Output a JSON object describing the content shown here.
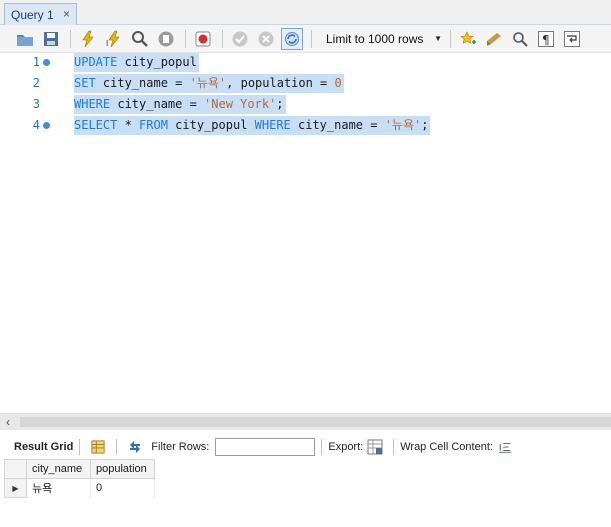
{
  "tab": {
    "title": "Query 1",
    "close": "×"
  },
  "toolbar": {
    "limit_label": "Limit to 1000 rows",
    "icons": [
      "open-folder-icon",
      "save-icon",
      "execute-icon",
      "execute-current-icon",
      "explain-icon",
      "stop-icon",
      "toggle-stop-on-error-icon",
      "commit-icon",
      "rollback-icon",
      "autocommit-icon",
      "beautify-icon",
      "find-icon",
      "invisible-chars-icon",
      "wrap-icon"
    ]
  },
  "editor": {
    "lines": [
      {
        "n": "1",
        "tokens": [
          {
            "t": "kw",
            "v": "UPDATE"
          },
          {
            "t": "plain",
            "v": " city_popul"
          }
        ]
      },
      {
        "n": "2",
        "tokens": [
          {
            "t": "kw",
            "v": "SET"
          },
          {
            "t": "plain",
            "v": " city_name = "
          },
          {
            "t": "str",
            "v": "'뉴욕'"
          },
          {
            "t": "plain",
            "v": ", population = "
          },
          {
            "t": "num",
            "v": "0"
          }
        ]
      },
      {
        "n": "3",
        "tokens": [
          {
            "t": "kw",
            "v": "WHERE"
          },
          {
            "t": "plain",
            "v": " city_name = "
          },
          {
            "t": "str",
            "v": "'New York'"
          },
          {
            "t": "plain",
            "v": ";"
          }
        ]
      },
      {
        "n": "4",
        "tokens": [
          {
            "t": "kw",
            "v": "SELECT"
          },
          {
            "t": "plain",
            "v": " * "
          },
          {
            "t": "kw",
            "v": "FROM"
          },
          {
            "t": "plain",
            "v": " city_popul "
          },
          {
            "t": "kw",
            "v": "WHERE"
          },
          {
            "t": "plain",
            "v": " city_name = "
          },
          {
            "t": "str",
            "v": "'뉴욕'"
          },
          {
            "t": "plain",
            "v": ";"
          }
        ]
      }
    ]
  },
  "results": {
    "result_grid_label": "Result Grid",
    "filter_rows_label": "Filter Rows:",
    "filter_value": "",
    "export_label": "Export:",
    "wrap_label": "Wrap Cell Content:",
    "columns": [
      "city_name",
      "population"
    ],
    "rows": [
      [
        "뉴욕",
        "0"
      ]
    ]
  },
  "colors": {
    "selection": "#c8def5",
    "keyword": "#1f7dd0",
    "string": "#b5693a",
    "line_number": "#2f6fb8"
  }
}
